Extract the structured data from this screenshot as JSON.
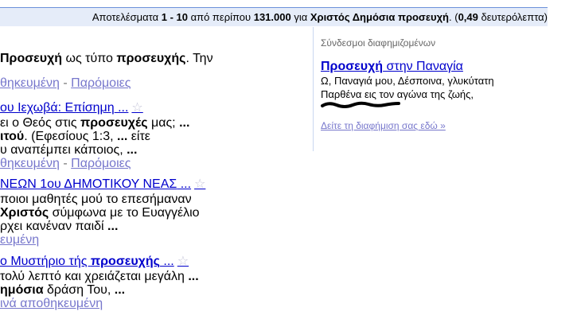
{
  "stats": {
    "pre": "Αποτελέσματα ",
    "range": "1 - 10",
    "mid": " από περίπου ",
    "count": "131.000",
    "for": " για ",
    "query": "Χριστός Δημόσια προσευχή",
    "post": ". (",
    "time": "0,49",
    "tail": " δευτερόλεπτα)"
  },
  "results": [
    {
      "snippet": [
        {
          "b": "Προσευχή",
          "t1": " ως τύπο ",
          "b2": "προσευχής",
          "t2": ". Την"
        }
      ],
      "cached": "θηκευμένη",
      "sep": " - ",
      "similar": "Παρόμοιες"
    },
    {
      "title_a": "ου Ιεχωβά: Επίσημη",
      "title_dots": " ...",
      "line1_a": "ει ο Θεός στις ",
      "line1_b": "προσευχές",
      "line1_c": " μας; ",
      "line1_d": "...",
      "line2_a": "ιτού",
      "line2_b": ". (Εφεσίους 1:3, ",
      "line2_c": "...",
      "line2_d": " είτε",
      "line3_a": "υ αναπέμπει κάποιος, ",
      "line3_b": "...",
      "cached": "θηκευμένη",
      "sep": " - ",
      "similar": "Παρόμοιες"
    },
    {
      "title_a": "ΝΕΩΝ 1ου ΔΗΜΟΤΙΚΟΥ ΝΕΑΣ",
      "title_dots": " ...",
      "line1_a": "ποιοι μαθητές μού το επεσήμαναν",
      "line2_b": "Χριστός",
      "line2_c": " σύμφωνα με το Ευαγγέλιο",
      "line3_a": "ρχει κανέναν παιδί ",
      "line3_b": "...",
      "cached": "ευμένη"
    },
    {
      "title_a": "ο Μυστήριο τής ",
      "title_b": "προσευχής",
      "title_dots": " ...",
      "line1_a": "τολύ λεπτό και χρειάζεται μεγάλη ",
      "line1_b": "...",
      "line2_b": "ημόσια",
      "line2_c": " δράση Του, ",
      "line2_d": "...",
      "cached": "ινά αποθηκευμένη"
    }
  ],
  "ads": {
    "header": "Σύνδεσμοι διαφημιζομένων",
    "title_b": "Προσευχή",
    "title_rest": " στην Παναγία",
    "line1": "Ω, Παναγιά μου, Δέσποινα, γλυκύτατη",
    "line2": "Παρθένα εις τον αγώνα της ζωής,",
    "see_ad": "Δείτε τη διαφήμιση σας εδώ »"
  },
  "icons": {
    "star": "star-icon"
  }
}
